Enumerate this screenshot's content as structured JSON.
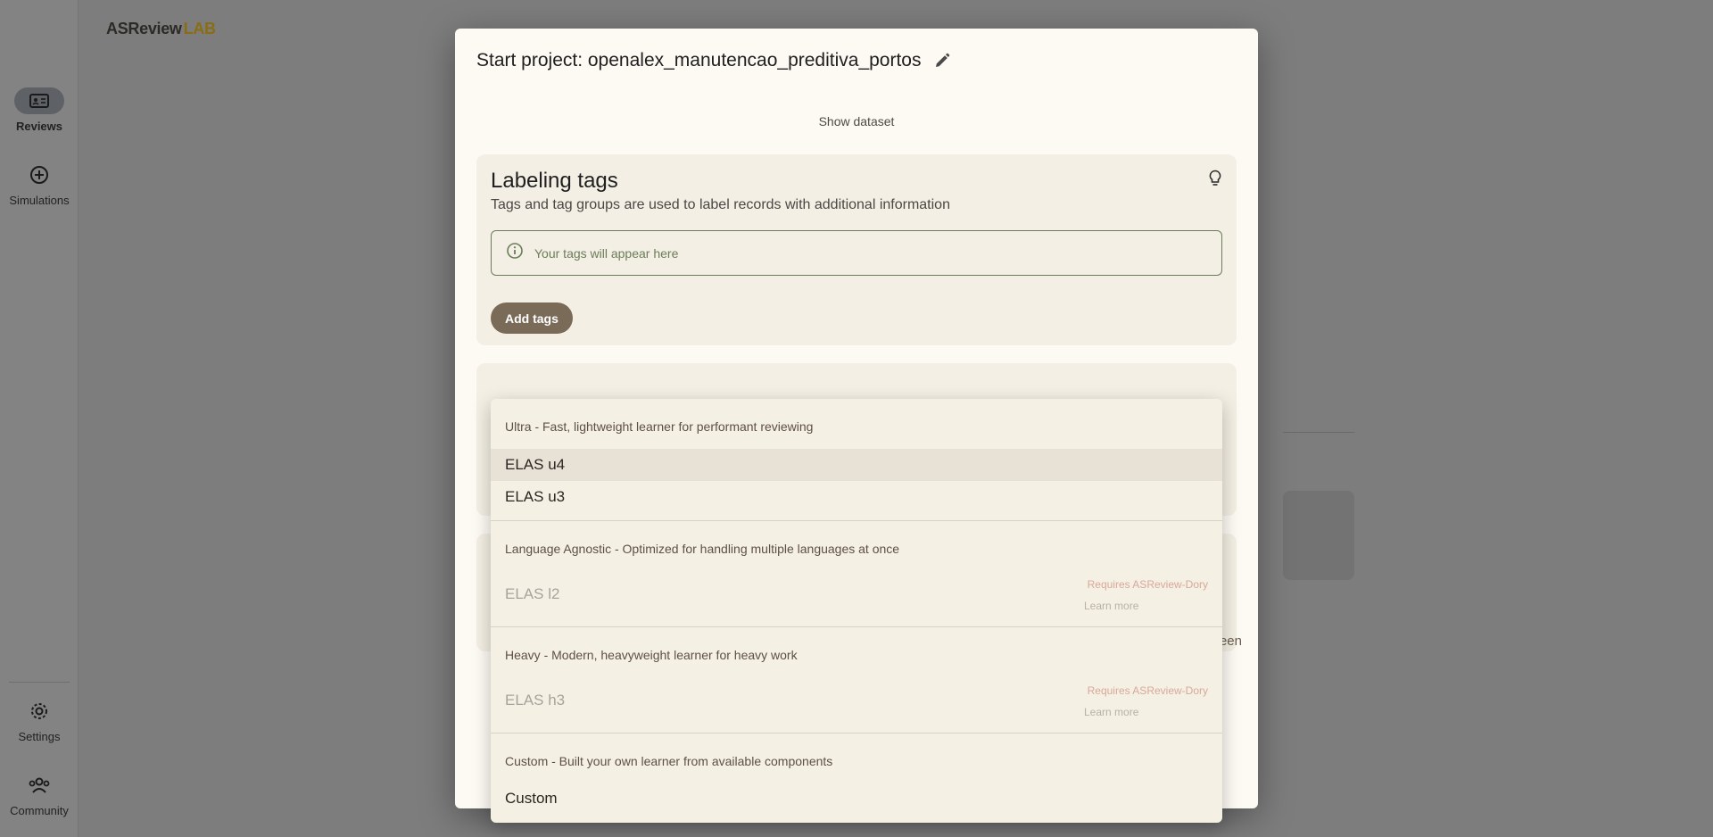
{
  "app": {
    "logo_main": "ASReview",
    "logo_lab": "LAB",
    "nav": [
      {
        "label": "Reviews",
        "icon": "reviews-icon",
        "active": true
      },
      {
        "label": "Simulations",
        "icon": "simulations-icon",
        "active": false
      },
      {
        "label": "Settings",
        "icon": "gear-icon",
        "active": false
      },
      {
        "label": "Community",
        "icon": "community-icon",
        "active": false
      }
    ]
  },
  "dialog": {
    "title": "Start project: openalex_manutencao_preditiva_portos",
    "show_dataset": "Show dataset",
    "tags_card": {
      "title": "Labeling tags",
      "subtitle": "Tags and tag groups are used to label records with additional information",
      "placeholder_message": "Your tags will appear here",
      "add_button": "Add tags"
    },
    "footer_partial": "een"
  },
  "model_menu": {
    "groups": [
      {
        "header": "Ultra - Fast, lightweight learner for performant reviewing",
        "options": [
          {
            "label": "ELAS u4",
            "highlighted": true,
            "disabled": false
          },
          {
            "label": "ELAS u3",
            "highlighted": false,
            "disabled": false
          }
        ]
      },
      {
        "header": "Language Agnostic - Optimized for handling multiple languages at once",
        "options": [
          {
            "label": "ELAS l2",
            "disabled": true,
            "requires": "Requires ASReview-Dory",
            "learn_more": "Learn more"
          }
        ]
      },
      {
        "header": "Heavy - Modern, heavyweight learner for heavy work",
        "options": [
          {
            "label": "ELAS h3",
            "disabled": true,
            "requires": "Requires ASReview-Dory",
            "learn_more": "Learn more"
          }
        ]
      },
      {
        "header": "Custom - Built your own learner from available components",
        "options": [
          {
            "label": "Custom",
            "disabled": false
          }
        ]
      }
    ]
  },
  "colors": {
    "dialog_bg": "#fdf9f3",
    "card_bg": "#f3efe4",
    "accent_button": "#7a6a58",
    "outline_green": "#6b7d58",
    "requires_text": "#d8a89a"
  }
}
